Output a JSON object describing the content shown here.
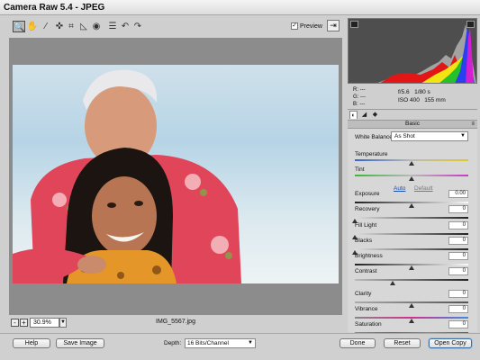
{
  "window": {
    "title": "Camera Raw 5.4  -  JPEG"
  },
  "toolbar": {
    "tools": [
      {
        "icon": "zoom-icon",
        "glyph": "🔍"
      },
      {
        "icon": "hand-icon",
        "glyph": "✋"
      },
      {
        "icon": "white-balance-icon",
        "glyph": "⁄"
      },
      {
        "icon": "color-sampler-icon",
        "glyph": "✜"
      },
      {
        "icon": "crop-icon",
        "glyph": "⌗"
      },
      {
        "icon": "straighten-icon",
        "glyph": "◺"
      },
      {
        "icon": "red-eye-icon",
        "glyph": "◉"
      },
      {
        "icon": "preferences-icon",
        "glyph": "☰"
      },
      {
        "icon": "rotate-left-icon",
        "glyph": "↶"
      },
      {
        "icon": "rotate-right-icon",
        "glyph": "↷"
      }
    ],
    "preview_label": "Preview",
    "preview_checked": true
  },
  "status": {
    "zoom": "30.9%",
    "filename": "IMG_5567.jpg"
  },
  "readout": {
    "r_label": "R:",
    "r_value": "---",
    "g_label": "G:",
    "g_value": "---",
    "b_label": "B:",
    "b_value": "---",
    "aperture": "f/5.6",
    "shutter": "1/80 s",
    "iso": "ISO 400",
    "focal_length": "155 mm"
  },
  "panel": {
    "title": "Basic",
    "white_balance_label": "White Balance:",
    "white_balance_value": "As Shot",
    "temperature_label": "Temperature",
    "tint_label": "Tint",
    "auto_label": "Auto",
    "default_label": "Default",
    "sliders": {
      "exposure": {
        "label": "Exposure",
        "value": "0.00",
        "level": 0.5
      },
      "recovery": {
        "label": "Recovery",
        "value": "0",
        "level": 0.0
      },
      "fill_light": {
        "label": "Fill Light",
        "value": "0",
        "level": 0.0
      },
      "blacks": {
        "label": "Blacks",
        "value": "0",
        "level": 0.0
      },
      "brightness": {
        "label": "Brightness",
        "value": "0",
        "level": 0.5
      },
      "contrast": {
        "label": "Contrast",
        "value": "0",
        "level": 0.33
      },
      "clarity": {
        "label": "Clarity",
        "value": "0",
        "level": 0.5
      },
      "vibrance": {
        "label": "Vibrance",
        "value": "0",
        "level": 0.5
      },
      "saturation": {
        "label": "Saturation",
        "value": "0",
        "level": 0.5
      }
    },
    "temperature_level": 0.5,
    "tint_level": 0.5
  },
  "bottom": {
    "help_label": "Help",
    "save_label": "Save Image",
    "depth_label": "Depth:",
    "depth_value": "16 Bits/Channel",
    "done_label": "Done",
    "reset_label": "Reset",
    "open_copy_label": "Open Copy"
  },
  "colors": {
    "accent": "#3a6ea5",
    "histogram_bg": "#4e4e4e"
  }
}
